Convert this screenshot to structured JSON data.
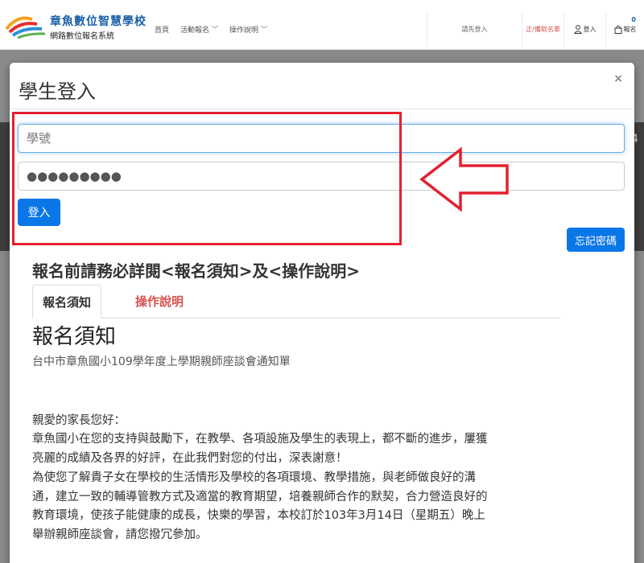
{
  "navbar": {
    "brand_title": "章魚數位智慧學校",
    "brand_subtitle": "網路數位報名系統",
    "links": [
      {
        "label": "首頁"
      },
      {
        "label": "活動報名"
      },
      {
        "label": "操作說明"
      }
    ],
    "login_first": "請先登入",
    "waitlist": "正/備取名單",
    "login": "登入",
    "signup": "報名",
    "cart_count": "0"
  },
  "modal": {
    "title": "學生登入",
    "close": "×",
    "student_id_placeholder": "學號",
    "password_value": "●●●●●●●●●",
    "login_button": "登入",
    "forgot_button": "忘記密碼"
  },
  "notice": {
    "heading": "報名前請務必詳閱<報名須知>及<操作說明>",
    "tabs": [
      "報名須知",
      "操作說明"
    ],
    "title": "報名須知",
    "subtitle": "台中市章魚國小109學年度上學期親師座談會通知單",
    "lines": [
      "",
      "親愛的家長您好：",
      "章魚國小在您的支持與鼓勵下，在教學、各項設施及學生的表現上，都不斷的進步，屢獲",
      "亮麗的成績及各界的好評，在此我們對您的付出，深表謝意！",
      "為使您了解貴子女在學校的生活情形及學校的各項環境、教學措施，與老師做良好的溝",
      "通，建立一致的輔導管教方式及適當的教育期望，培養親師合作的默契，合力營造良好的",
      "教育環境，使孩子能健康的成長，快樂的學習，本校訂於103年3月14日（星期五）晚上",
      "舉辦親師座談會，請您撥冗參加。"
    ]
  },
  "backdrop": {
    "edge_digit": "4"
  },
  "colors": {
    "primary": "#0a77e8",
    "highlight": "#e5202f",
    "danger_text": "#d9534f",
    "brand_blue": "#1a5fa8"
  }
}
